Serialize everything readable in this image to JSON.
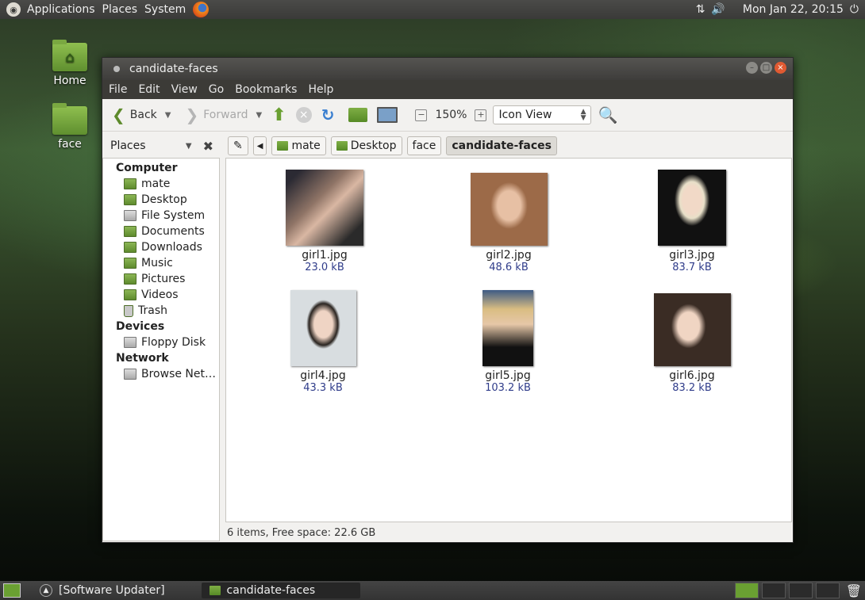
{
  "topbar": {
    "menus": [
      "Applications",
      "Places",
      "System"
    ],
    "clock": "Mon Jan 22, 20:15",
    "icons": [
      "network-icon",
      "volume-icon",
      "power-icon"
    ]
  },
  "desktop": {
    "icons": [
      {
        "label": "Home"
      },
      {
        "label": "face"
      }
    ]
  },
  "window": {
    "title": "candidate-faces",
    "menubar": [
      "File",
      "Edit",
      "View",
      "Go",
      "Bookmarks",
      "Help"
    ],
    "toolbar": {
      "back": "Back",
      "forward": "Forward",
      "zoom": "150%",
      "view_mode": "Icon View"
    },
    "sidebar_header": "Places",
    "path": [
      "mate",
      "Desktop",
      "face",
      "candidate-faces"
    ],
    "sidebar": {
      "computer": "Computer",
      "computer_items": [
        "mate",
        "Desktop",
        "File System",
        "Documents",
        "Downloads",
        "Music",
        "Pictures",
        "Videos",
        "Trash"
      ],
      "devices": "Devices",
      "devices_items": [
        "Floppy Disk"
      ],
      "network": "Network",
      "network_items": [
        "Browse Net…"
      ]
    },
    "files": [
      {
        "name": "girl1.jpg",
        "size": "23.0 kB"
      },
      {
        "name": "girl2.jpg",
        "size": "48.6 kB"
      },
      {
        "name": "girl3.jpg",
        "size": "83.7 kB"
      },
      {
        "name": "girl4.jpg",
        "size": "43.3 kB"
      },
      {
        "name": "girl5.jpg",
        "size": "103.2 kB"
      },
      {
        "name": "girl6.jpg",
        "size": "83.2 kB"
      }
    ],
    "status": "6 items, Free space: 22.6 GB"
  },
  "taskbar": {
    "tasks": [
      "[Software Updater]",
      "candidate-faces"
    ]
  }
}
